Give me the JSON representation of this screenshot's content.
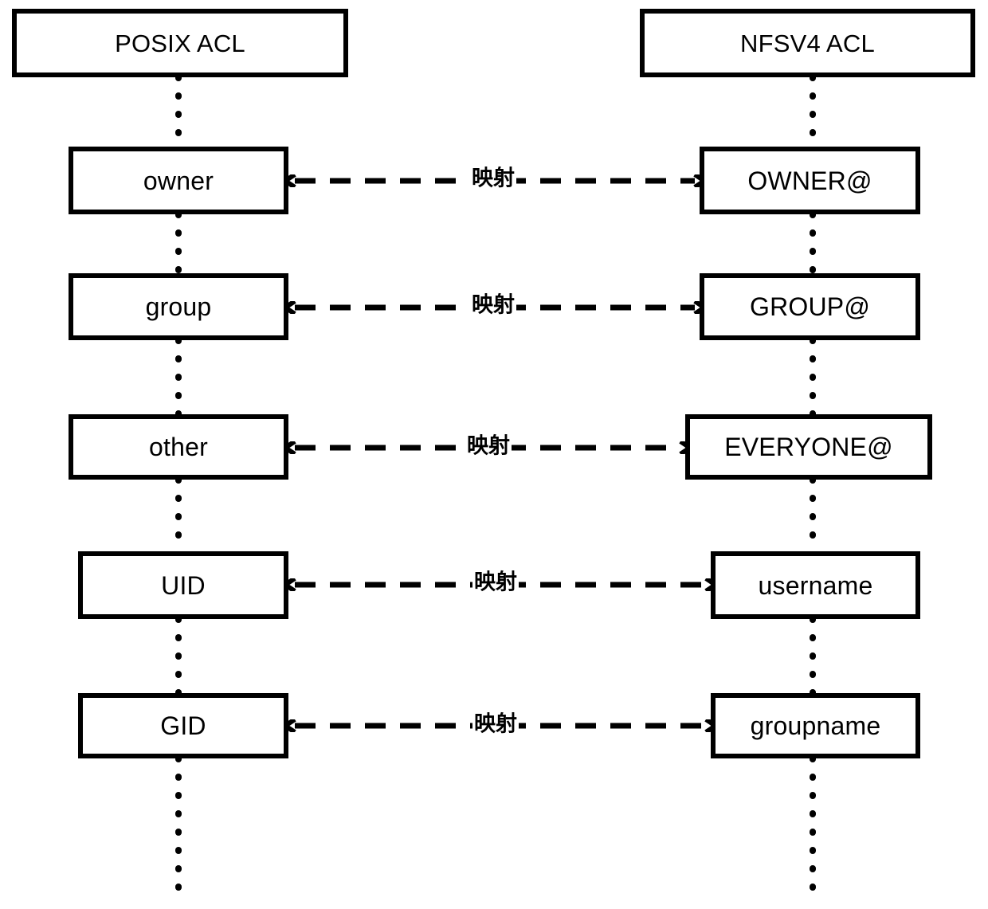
{
  "diagram": {
    "title_left": "POSIX ACL",
    "title_right": "NFSV4 ACL",
    "colors": {
      "stroke": "#000000",
      "fill": "#ffffff",
      "text": "#000000"
    },
    "columns": [
      {
        "id": "posix",
        "header": "POSIX ACL"
      },
      {
        "id": "nfsv4",
        "header": "NFSV4 ACL"
      }
    ],
    "rows": [
      {
        "left": "owner",
        "right": "OWNER@",
        "label": "映射"
      },
      {
        "left": "group",
        "right": "GROUP@",
        "label": "映射"
      },
      {
        "left": "other",
        "right": "EVERYONE@",
        "label": "映射"
      },
      {
        "left": "UID",
        "right": "username",
        "label": "映射"
      },
      {
        "left": "GID",
        "right": "groupname",
        "label": "映射"
      }
    ]
  }
}
